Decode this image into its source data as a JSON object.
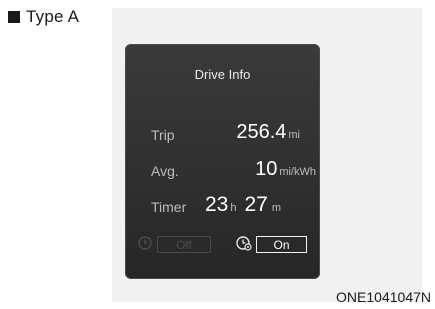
{
  "section_label": "Type A",
  "screen": {
    "title": "Drive Info",
    "trip": {
      "label": "Trip",
      "value": "256.4",
      "unit": "mi"
    },
    "avg": {
      "label": "Avg.",
      "value": "10",
      "unit": "mi/kWh"
    },
    "timer": {
      "label": "Timer",
      "hours": "23",
      "hours_unit": "h",
      "minutes": "27",
      "minutes_unit": "m"
    },
    "off_button": "Off",
    "on_button": "On"
  },
  "caption": "ONE1041047N",
  "icons": {
    "off_icon": "clock-icon",
    "on_icon": "clock-gear-icon"
  },
  "colors": {
    "screen_bg": "#303030",
    "text_primary": "#ffffff",
    "text_secondary": "#bdbdbd",
    "disabled": "#4d4d4d"
  }
}
